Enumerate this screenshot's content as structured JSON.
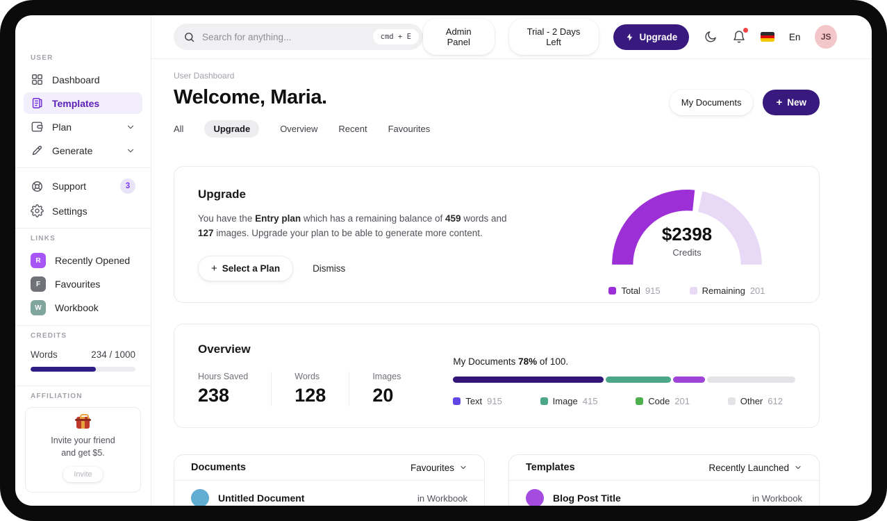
{
  "colors": {
    "accent": "#38197d",
    "sidebar_active_bg": "#f3eefb",
    "badge_recently": "#a855f7",
    "badge_favourites": "#71717a",
    "badge_workbook": "#7fa59d",
    "credits_fill": "#2f1d86",
    "notification_dot": "#ef4444",
    "avatar_bg": "#f3c6c9",
    "flag_black": "#2b2b2b",
    "flag_red": "#dd0b0b",
    "flag_gold": "#f5c500",
    "gauge_total": "#9c2fd6",
    "gauge_remaining": "#e8d9f6",
    "bar_text": "#331479",
    "bar_image": "#4ca788",
    "bar_code": "#a044d8",
    "bar_other": "#e4e4e7",
    "legend_text": "#6246e5",
    "legend_image": "#4ca788",
    "legend_code": "#4cb04f",
    "legend_other": "#e4e4e7",
    "doc_avatar": "#62aed2",
    "template_avatar": "#a44ce0"
  },
  "sidebar": {
    "user_label": "USER",
    "nav": [
      {
        "label": "Dashboard"
      },
      {
        "label": "Templates"
      },
      {
        "label": "Plan"
      },
      {
        "label": "Generate"
      }
    ],
    "support": {
      "label": "Support",
      "badge": "3"
    },
    "settings": {
      "label": "Settings"
    },
    "links_label": "LINKS",
    "links": [
      {
        "initial": "R",
        "label": "Recently Opened"
      },
      {
        "initial": "F",
        "label": "Favourites"
      },
      {
        "initial": "W",
        "label": "Workbook"
      }
    ],
    "credits_label": "CREDITS",
    "credits": {
      "label": "Words",
      "value": "234 / 1000",
      "percent": 62
    },
    "affiliation_label": "AFFILIATION",
    "affiliation": {
      "line1": "Invite your friend",
      "line2": "and get $5.",
      "button": "Invite"
    }
  },
  "topbar": {
    "search_placeholder": "Search for anything...",
    "search_kbd": "cmd + E",
    "admin_panel": "Admin Panel",
    "trial": "Trial - 2 Days Left",
    "upgrade": "Upgrade",
    "language": "En",
    "avatar_initials": "JS"
  },
  "header": {
    "breadcrumb": "User Dashboard",
    "title": "Welcome, Maria.",
    "tabs": [
      "All",
      "Upgrade",
      "Overview",
      "Recent",
      "Favourites"
    ],
    "my_documents": "My Documents",
    "new_plus": "+",
    "new_label": "New"
  },
  "upgrade_card": {
    "title": "Upgrade",
    "p1": "You have the ",
    "p2": "Entry plan",
    "p3": " which has a remaining balance of ",
    "p4": "459",
    "p5": " words and ",
    "p6": "127",
    "p7": " images. Upgrade your plan to be able to generate more content.",
    "select_plus": "+",
    "select_label": "Select a Plan",
    "dismiss": "Dismiss",
    "gauge_value": "$2398",
    "gauge_caption": "Credits",
    "legend": [
      {
        "label": "Total",
        "value": "915"
      },
      {
        "label": "Remaining",
        "value": "201"
      }
    ]
  },
  "overview_card": {
    "title": "Overview",
    "stats": [
      {
        "label": "Hours Saved",
        "value": "238"
      },
      {
        "label": "Words",
        "value": "128"
      },
      {
        "label": "Images",
        "value": "20"
      }
    ],
    "progress_p1": "My Documents ",
    "progress_p2": "78%",
    "progress_p3": " of 100.",
    "segments": [
      {
        "pct": 44
      },
      {
        "pct": 19
      },
      {
        "pct": 9.5
      }
    ],
    "legend": [
      {
        "label": "Text",
        "value": "915"
      },
      {
        "label": "Image",
        "value": "415"
      },
      {
        "label": "Code",
        "value": "201"
      },
      {
        "label": "Other",
        "value": "612"
      }
    ]
  },
  "documents_card": {
    "title": "Documents",
    "filter": "Favourites",
    "row": {
      "name": "Untitled Document",
      "location": "in Workbook"
    }
  },
  "templates_card": {
    "title": "Templates",
    "filter": "Recently Launched",
    "row": {
      "name": "Blog Post Title",
      "location": "in Workbook"
    }
  },
  "chart_data": [
    {
      "type": "pie",
      "subtype": "semi-donut-gauge",
      "title": "Credits gauge",
      "center_label": "$2398",
      "center_caption": "Credits",
      "categories": [
        "Total",
        "Remaining"
      ],
      "values": [
        915,
        201
      ],
      "visual_sweep_degrees": {
        "Total": 96,
        "Remaining": 78
      },
      "colors": [
        "#9c2fd6",
        "#e8d9f6"
      ],
      "legend_position": "bottom"
    },
    {
      "type": "bar",
      "subtype": "stacked-progress",
      "title": "My Documents 78% of 100.",
      "categories": [
        "Text",
        "Image",
        "Code",
        "Other"
      ],
      "values": [
        915,
        415,
        201,
        612
      ],
      "segment_percents": [
        44,
        19,
        9.5,
        27.5
      ],
      "colors": [
        "#331479",
        "#4ca788",
        "#a044d8",
        "#e4e4e7"
      ],
      "legend_position": "bottom"
    }
  ]
}
